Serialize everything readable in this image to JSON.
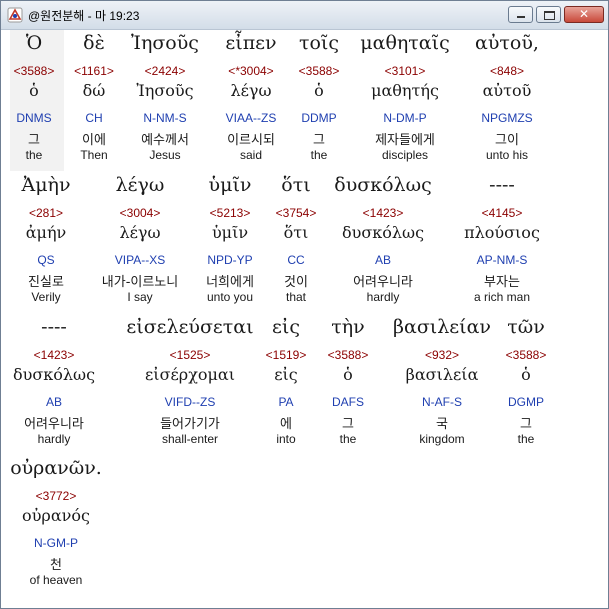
{
  "window": {
    "title": "@원전분해 - 마 19:23"
  },
  "rows": [
    {
      "words": [
        {
          "greek": "Ὁ",
          "strong": "<3588>",
          "lemma": "ὁ",
          "parse": "DNMS",
          "korean": "그",
          "english": "the"
        },
        {
          "greek": "δὲ",
          "strong": "<1161>",
          "lemma": "δώ",
          "parse": "CH",
          "korean": "이에",
          "english": "Then"
        },
        {
          "greek": "Ἰησοῦς",
          "strong": "<2424>",
          "lemma": "Ἰησοῦς",
          "parse": "N-NM-S",
          "korean": "예수께서",
          "english": "Jesus"
        },
        {
          "greek": "εἶπεν",
          "strong": "<*3004>",
          "lemma": "λέγω",
          "parse": "VIAA--ZS",
          "korean": "이르시되",
          "english": "said"
        },
        {
          "greek": "τοῖς",
          "strong": "<3588>",
          "lemma": "ὁ",
          "parse": "DDMP",
          "korean": "그",
          "english": "the"
        },
        {
          "greek": "μαθηταῖς",
          "strong": "<3101>",
          "lemma": "μαθητής",
          "parse": "N-DM-P",
          "korean": "제자들에게",
          "english": "disciples"
        },
        {
          "greek": "αὐτοῦ,",
          "strong": "<848>",
          "lemma": "αὐτοῦ",
          "parse": "NPGMZS",
          "korean": "그이",
          "english": "unto his"
        }
      ]
    },
    {
      "words": [
        {
          "greek": "Ἀμὴν",
          "strong": "<281>",
          "lemma": "ἀμήν",
          "parse": "QS",
          "korean": "진실로",
          "english": "Verily"
        },
        {
          "greek": "λέγω",
          "strong": "<3004>",
          "lemma": "λέγω",
          "parse": "VIPA--XS",
          "korean": "내가-이르노니",
          "english": "I say"
        },
        {
          "greek": "ὑμῖν",
          "strong": "<5213>",
          "lemma": "ὑμῖν",
          "parse": "NPD-YP",
          "korean": "너희에게",
          "english": "unto you"
        },
        {
          "greek": "ὅτι",
          "strong": "<3754>",
          "lemma": "ὅτι",
          "parse": "CC",
          "korean": "것이",
          "english": "that"
        },
        {
          "greek": "δυσκόλως",
          "strong": "<1423>",
          "lemma": "δυσκόλως",
          "parse": "AB",
          "korean": "어려우니라",
          "english": "hardly"
        },
        {
          "greek": "----",
          "strong": "<4145>",
          "lemma": "πλούσιος",
          "parse": "AP-NM-S",
          "korean": "부자는",
          "english": "a rich man"
        }
      ]
    },
    {
      "words": [
        {
          "greek": "----",
          "strong": "<1423>",
          "lemma": "δυσκόλως",
          "parse": "AB",
          "korean": "어려우니라",
          "english": "hardly"
        },
        {
          "greek": "εἰσελεύσεται",
          "strong": "<1525>",
          "lemma": "εἰσέρχομαι",
          "parse": "VIFD--ZS",
          "korean": "들어가기가",
          "english": "shall-enter"
        },
        {
          "greek": "εἰς",
          "strong": "<1519>",
          "lemma": "εἰς",
          "parse": "PA",
          "korean": "에",
          "english": "into"
        },
        {
          "greek": "τὴν",
          "strong": "<3588>",
          "lemma": "ὁ",
          "parse": "DAFS",
          "korean": "그",
          "english": "the"
        },
        {
          "greek": "βασιλείαν",
          "strong": "<932>",
          "lemma": "βασιλεία",
          "parse": "N-AF-S",
          "korean": "국",
          "english": "kingdom"
        },
        {
          "greek": "τῶν",
          "strong": "<3588>",
          "lemma": "ὁ",
          "parse": "DGMP",
          "korean": "그",
          "english": "the"
        }
      ]
    },
    {
      "words": [
        {
          "greek": "οὐρανῶν.",
          "strong": "<3772>",
          "lemma": "οὐρανός",
          "parse": "N-GM-P",
          "korean": "천",
          "english": "of heaven"
        }
      ]
    }
  ]
}
